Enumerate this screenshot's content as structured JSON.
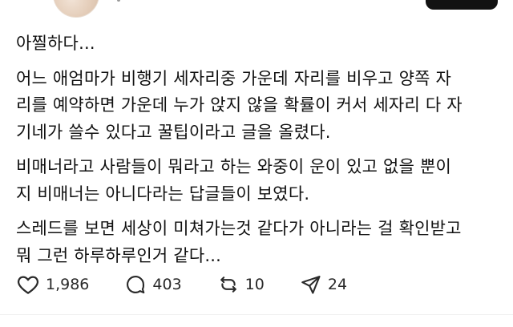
{
  "post": {
    "paragraphs": [
      {
        "lines": [
          "아찔하다..."
        ]
      },
      {
        "lines": [
          "어느 애엄마가 비행기 세자리중 가운데 자리를 비우고 양쪽 자",
          "리를 예약하면 가운데 누가 앉지 않을 확률이 커서 세자리 다 자",
          "기네가 쓸수 있다고 꿀팁이라고 글을 올렸다."
        ]
      },
      {
        "lines": [
          "비매너라고 사람들이 뭐라고 하는 와중이 운이 있고 없을 뿐이",
          "지 비매너는 아니다라는 답글들이 보였다."
        ]
      },
      {
        "lines": [
          "스레드를 보면 세상이 미쳐가는것 같다가 아니라는 걸 확인받고",
          "뭐 그런 하루하루인거 같다..."
        ]
      }
    ]
  },
  "actions": {
    "like": {
      "icon": "heart-icon",
      "count": "1,986"
    },
    "reply": {
      "icon": "comment-icon",
      "count": "403"
    },
    "repost": {
      "icon": "repost-icon",
      "count": "10"
    },
    "share": {
      "icon": "send-icon",
      "count": "24"
    }
  },
  "colors": {
    "text": "#101010",
    "icon": "#2a2a2a",
    "follow_button": "#121212"
  }
}
